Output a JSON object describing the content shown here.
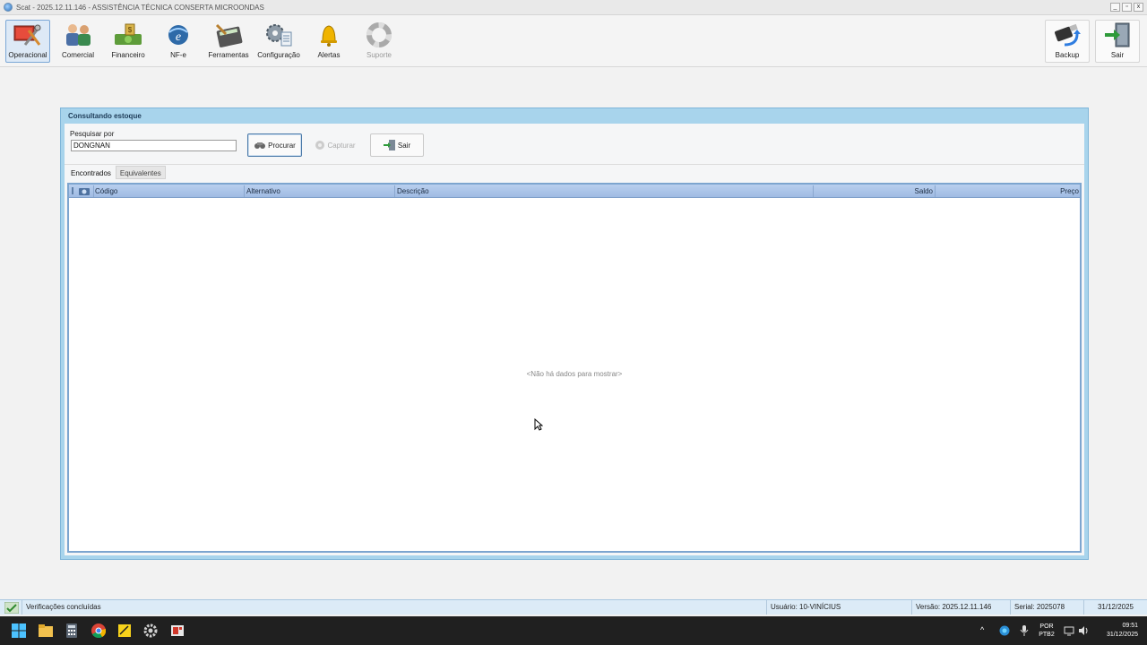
{
  "window": {
    "title": "Scat - 2025.12.11.146 - ASSISTÊNCIA TÉCNICA CONSERTA MICROONDAS",
    "controls": [
      "_",
      "▫",
      "x"
    ]
  },
  "toolbar": {
    "operacional": "Operacional",
    "comercial": "Comercial",
    "financeiro": "Financeiro",
    "nfe": "NF-e",
    "ferramentas": "Ferramentas",
    "configuracao": "Configuração",
    "alertas": "Alertas",
    "suporte": "Suporte",
    "backup": "Backup",
    "sair": "Sair"
  },
  "dialog": {
    "title": "Consultando estoque",
    "search_label": "Pesquisar por",
    "search_value": "DONGNAN",
    "procurar": "Procurar",
    "capturar": "Capturar",
    "sair": "Sair",
    "tabs": [
      "Encontrados",
      "Equivalentes"
    ],
    "columns": {
      "codigo": "Código",
      "alternativo": "Alternativo",
      "descricao": "Descrição",
      "saldo": "Saldo",
      "preco": "Preço"
    },
    "empty_message": "<Não há dados para mostrar>"
  },
  "statusbar": {
    "message": "Verificações concluídas",
    "usuario": "Usuário: 10-VINÍCIUS",
    "versao": "Versão: 2025.12.11.146",
    "serial": "Serial: 2025078",
    "date": "31/12/2025"
  },
  "taskbar": {
    "lang_top": "POR",
    "lang_bottom": "PTB2",
    "time": "09:51",
    "date": "31/12/2025"
  },
  "colors": {
    "dialog_frame": "#a8d4ec",
    "grid_header": "#b9cfee",
    "status_bar": "#dcebf7",
    "taskbar": "#202020"
  }
}
